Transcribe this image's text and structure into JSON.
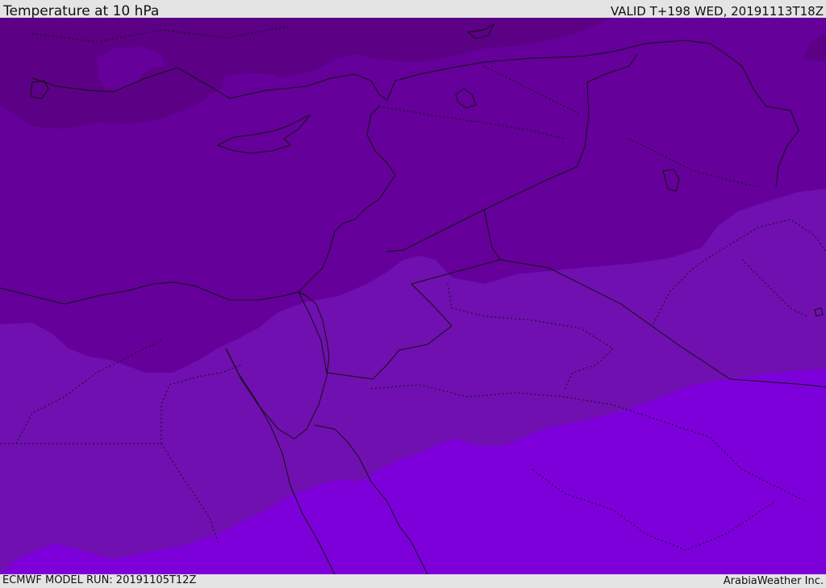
{
  "header": {
    "title": "Temperature at 10 hPa",
    "valid_time": "VALID T+198 WED, 20191113T18Z"
  },
  "footer": {
    "model_run": "ECMWF MODEL RUN: 20191105T12Z",
    "credit": "ArabiaWeather Inc."
  },
  "map": {
    "fill_colors": {
      "coldest": "#5c0086",
      "cold": "#65009a",
      "mid": "#7010b0",
      "warm": "#7d00db"
    },
    "border_color": "#111111"
  }
}
